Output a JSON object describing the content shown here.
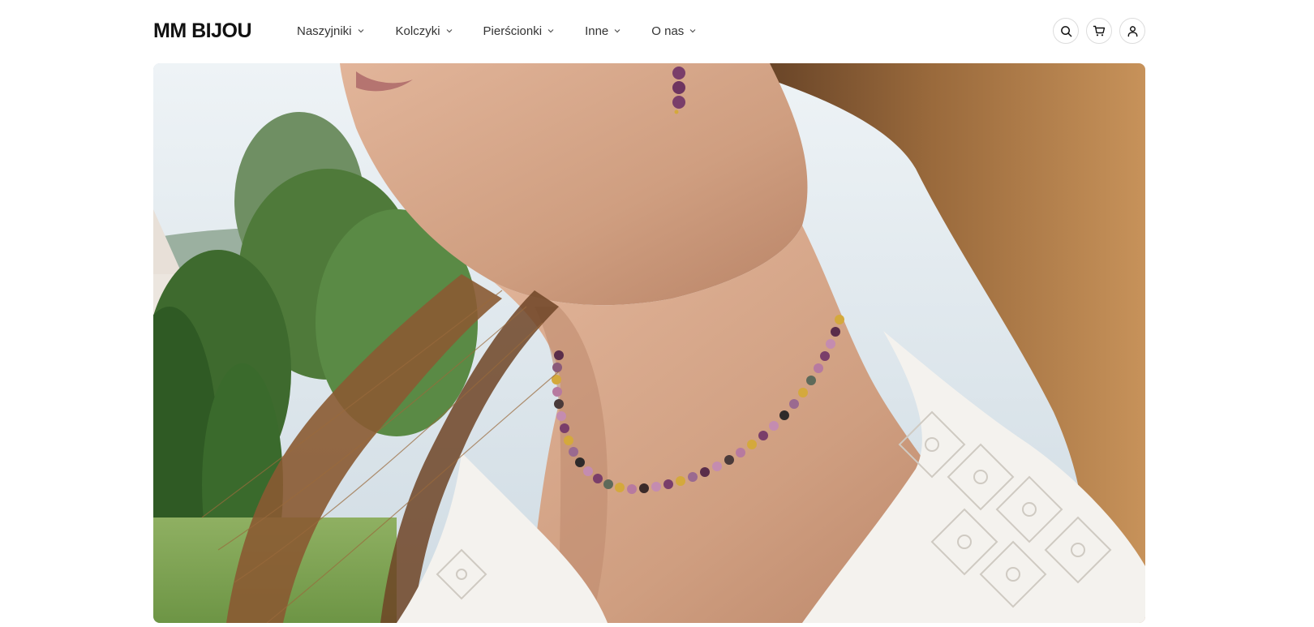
{
  "header": {
    "logo": "MM BIJOU",
    "nav": [
      {
        "label": "Naszyjniki"
      },
      {
        "label": "Kolczyki"
      },
      {
        "label": "Pierścionki"
      },
      {
        "label": "Inne"
      },
      {
        "label": "O nas"
      }
    ],
    "icons": [
      "search-icon",
      "cart-icon",
      "user-icon"
    ]
  },
  "hero": {
    "image_subject": "woman wearing beaded gemstone choker necklace and drop earring",
    "colors": {
      "skin": "#d6a98c",
      "hair": "#8a5a32",
      "blouse": "#f4f2ee",
      "foliage": "#4f7a3a",
      "sky": "#dfe8ef",
      "bead_purple": "#7a3e6a",
      "bead_gold": "#d4a93c"
    }
  },
  "theme": {
    "text": "#1a1a1a",
    "nav_text": "#333333",
    "border": "#dcdcdc",
    "background": "#ffffff"
  }
}
